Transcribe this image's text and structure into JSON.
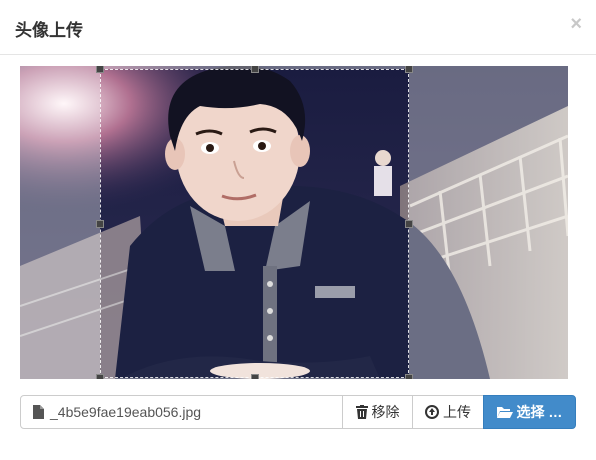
{
  "dialog": {
    "title": "头像上传",
    "close_label": "×"
  },
  "file": {
    "name": "_4b5e9fae19eab056.jpg",
    "remove_label": "移除",
    "upload_label": "上传",
    "select_label": "选择 …"
  },
  "colors": {
    "primary": "#428bca",
    "border": "#cccccc"
  },
  "icons": {
    "file": "file-icon",
    "remove": "trash-icon",
    "upload": "upload-circle-icon",
    "select": "folder-open-icon"
  }
}
